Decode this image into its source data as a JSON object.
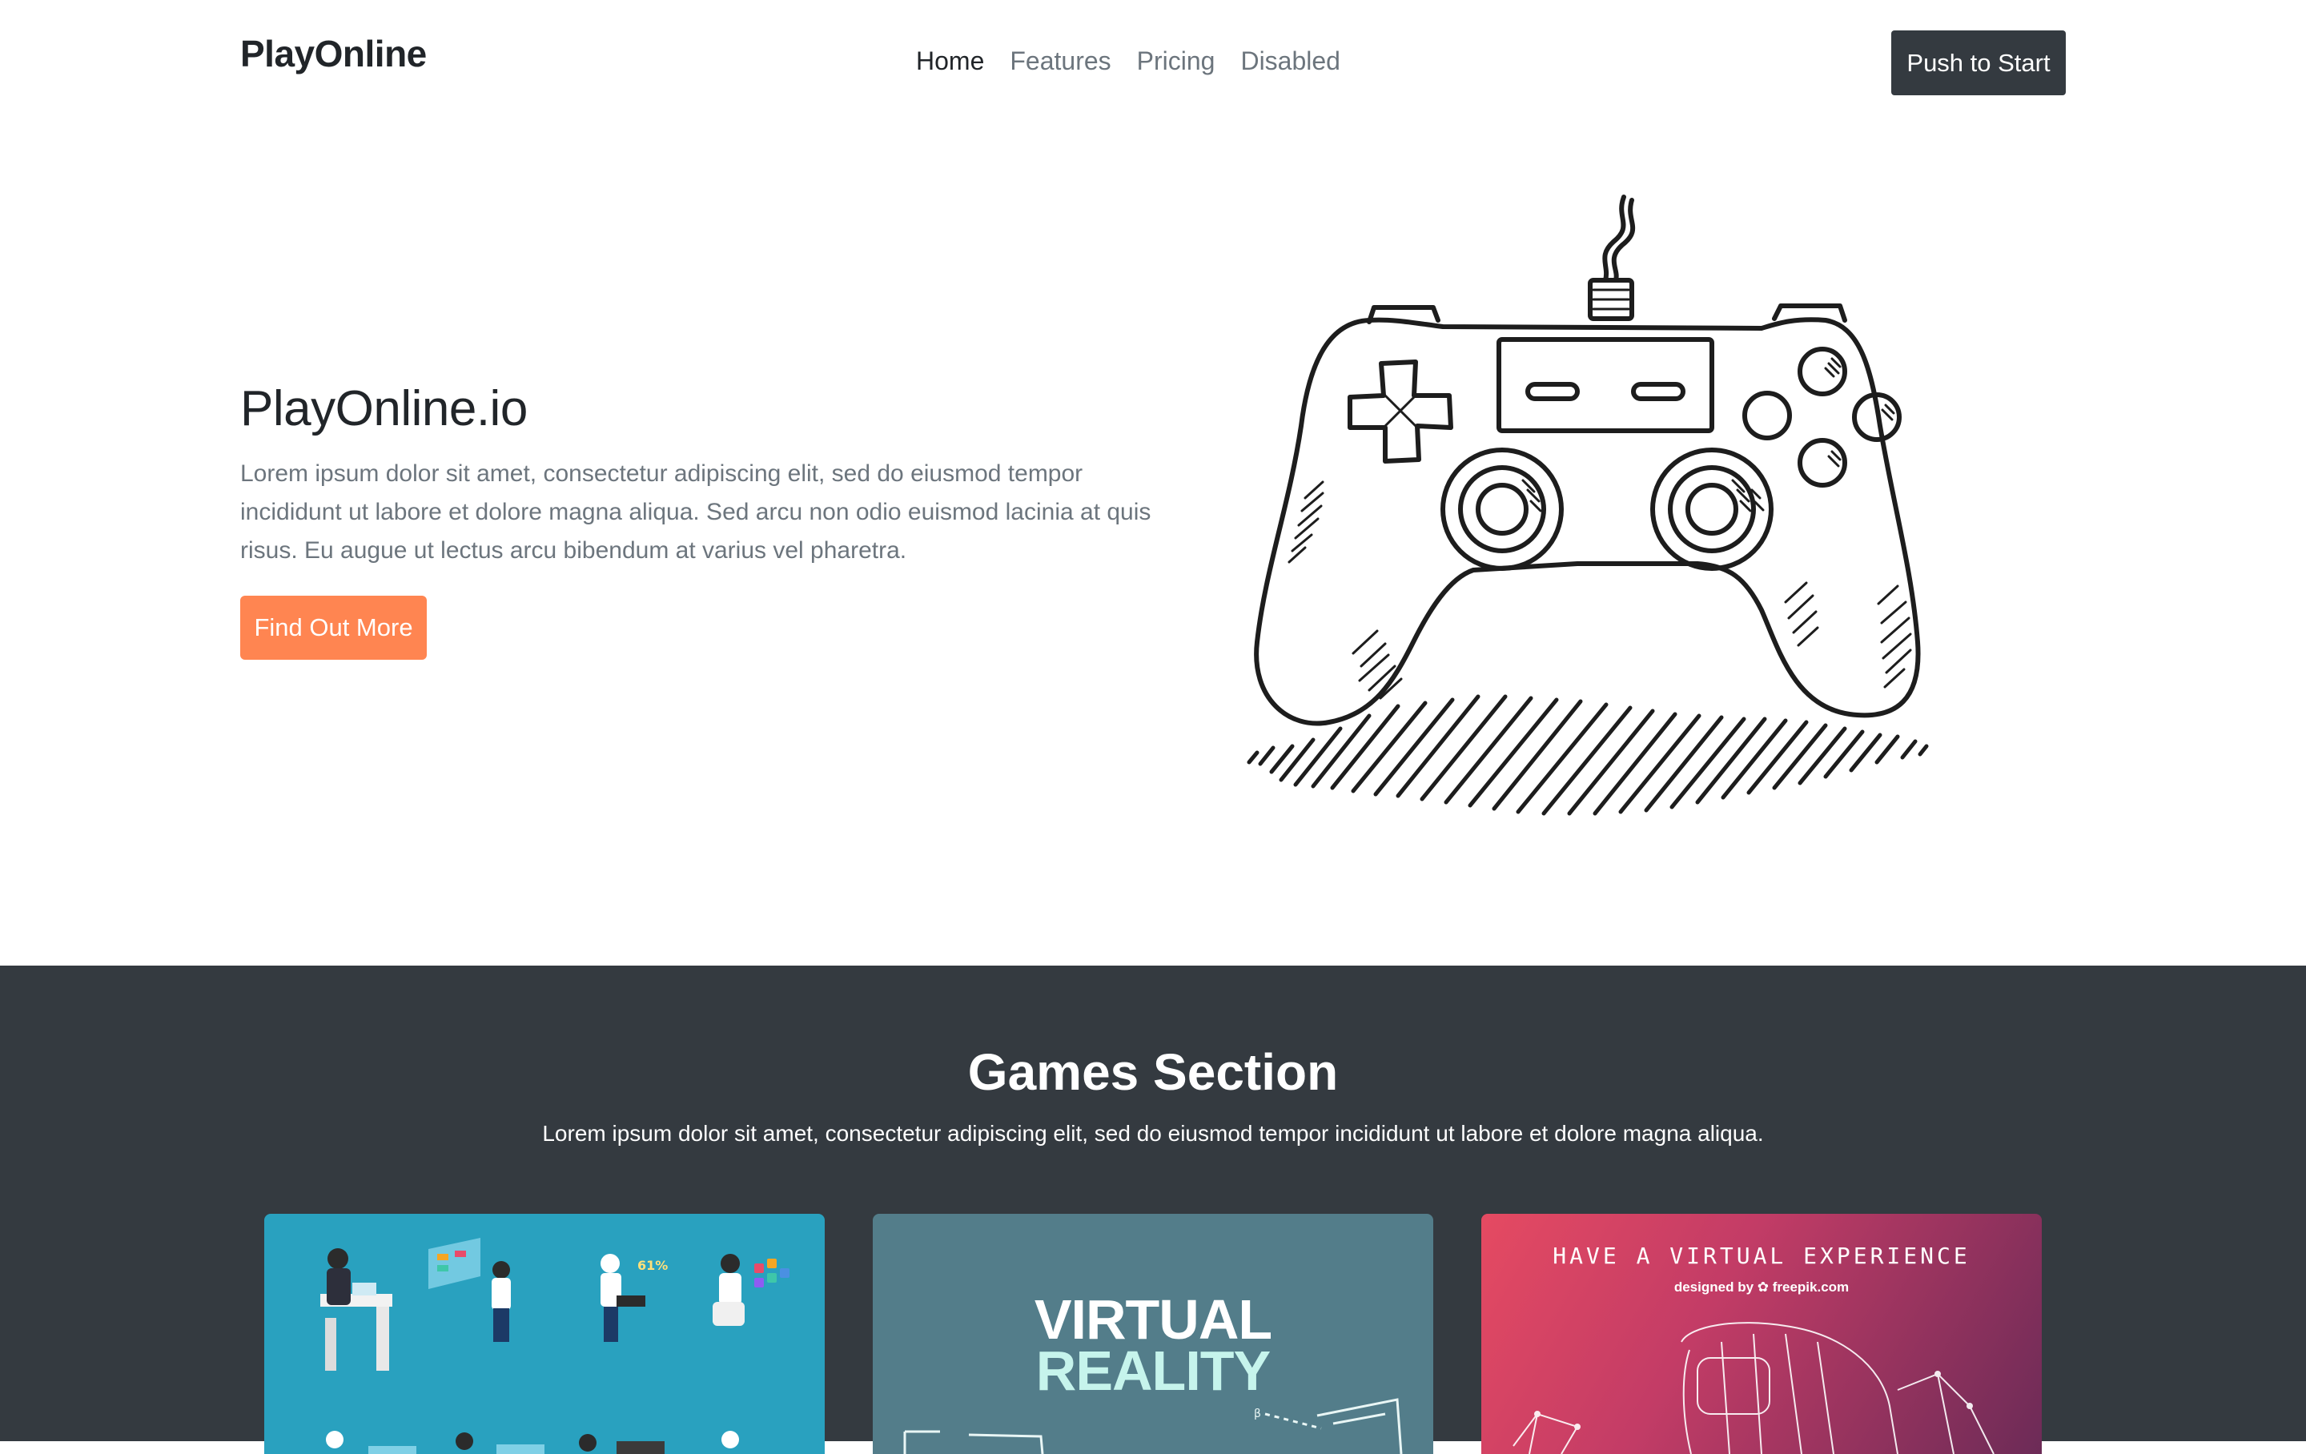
{
  "navbar": {
    "brand": "PlayOnline",
    "links": [
      "Home",
      "Features",
      "Pricing",
      "Disabled"
    ],
    "cta_label": "Push to Start"
  },
  "hero": {
    "title": "PlayOnline.io",
    "lead": "Lorem ipsum dolor sit amet, consectetur adipiscing elit, sed do eiusmod tempor incididunt ut labore et dolore magna aliqua. Sed arcu non odio euismod lacinia at quis risus. Eu augue ut lectus arcu bibendum at varius vel pharetra.",
    "button_label": "Find Out More",
    "image_icon": "gamepad-sketch"
  },
  "games": {
    "title": "Games Section",
    "subtitle": "Lorem ipsum dolor sit amet, consectetur adipiscing elit, sed do eiusmod tempor incididunt ut labore et dolore magna aliqua.",
    "cards": [
      {
        "image": "isometric-people-illustration",
        "color": "#29a1bf"
      },
      {
        "image": "virtual-reality-illustration",
        "line1": "VIRTUAL",
        "line2": "REALITY",
        "color": "#537d8a"
      },
      {
        "image": "vr-headset-illustration",
        "headline": "HAVE A VIRTUAL EXPERIENCE",
        "credit": "designed by ✿ freepik.com",
        "color": "#e54a62"
      }
    ]
  },
  "colors": {
    "primary_dark": "#343a40",
    "accent": "#ff8551",
    "muted": "#6c757d"
  }
}
